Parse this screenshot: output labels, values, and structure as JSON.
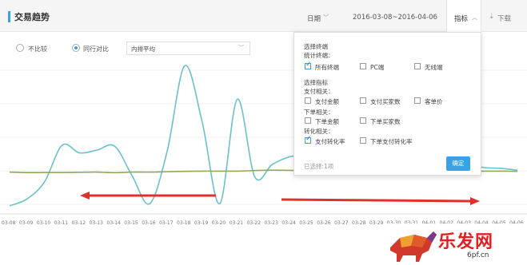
{
  "header": {
    "title": "交易趋势",
    "date_label": "日期",
    "date_range": "2016-03-08~2016-04-06",
    "metric_label": "指标",
    "download_label": "下载"
  },
  "compare": {
    "options": [
      {
        "label": "不比较",
        "selected": false
      },
      {
        "label": "同行对比",
        "selected": true
      }
    ],
    "select_value": "内排平均"
  },
  "dropdown": {
    "section1_title": "选择终端",
    "section1_sub": "统计终端：",
    "terminals": [
      {
        "label": "所有终端",
        "checked": true
      },
      {
        "label": "PC端",
        "checked": false
      },
      {
        "label": "无线端",
        "checked": false
      }
    ],
    "section2_title": "选择指标",
    "pay_group": "支付相关：",
    "pay_items": [
      {
        "label": "支付金额",
        "checked": false
      },
      {
        "label": "支付买家数",
        "checked": false
      },
      {
        "label": "客单价",
        "checked": false
      }
    ],
    "order_group": "下单相关：",
    "order_items": [
      {
        "label": "下单金额",
        "checked": false
      },
      {
        "label": "下单买家数",
        "checked": false
      }
    ],
    "conv_group": "转化相关：",
    "conv_items": [
      {
        "label": "支付转化率",
        "checked": true
      },
      {
        "label": "下单支付转化率",
        "checked": false
      }
    ],
    "selected_info": "已选择:1项",
    "confirm_label": "确定"
  },
  "chart_data": {
    "type": "line",
    "x": [
      "03-08",
      "03-09",
      "03-10",
      "03-11",
      "03-12",
      "03-13",
      "03-14",
      "03-15",
      "03-16",
      "03-17",
      "03-18",
      "03-19",
      "03-20",
      "03-21",
      "03-22",
      "03-23",
      "03-24",
      "03-25",
      "03-26",
      "03-27",
      "03-28",
      "03-29",
      "03-30",
      "03-31",
      "04-01",
      "04-02",
      "04-03",
      "04-04",
      "04-05",
      "04-06"
    ],
    "series": [
      {
        "values": [
          -3.2,
          4.0,
          22.0,
          60.0,
          52.0,
          55.0,
          59.0,
          28.0,
          -1.0,
          54.0,
          143.0,
          84.0,
          -1.0,
          108.0,
          27.0,
          40.0,
          48.0,
          50.0,
          53.0,
          48.0,
          50.0,
          37.0,
          46.0,
          41.0,
          36.0,
          46.0,
          43.0,
          37.0,
          36.0,
          34.0
        ],
        "color": "#6cc0cc"
      },
      {
        "values": [
          32.0,
          31.5,
          31.6,
          31.6,
          31.8,
          32.0,
          31.4,
          32.0,
          32.0,
          32.4,
          32.8,
          33.0,
          33.0,
          33.0,
          33.6,
          34.0,
          33.8,
          33.6,
          33.8,
          33.8,
          33.8,
          33.4,
          33.4,
          33.4,
          33.4,
          33.2,
          33.2,
          33.0,
          33.0,
          32.8
        ],
        "color": "#8fa85a"
      }
    ],
    "ylim": [
      0,
      150
    ],
    "grid": false,
    "annotations": [
      "red arrows indicating left and right"
    ]
  },
  "watermark": {
    "text": "乐发网",
    "url": "6pf.cn"
  }
}
